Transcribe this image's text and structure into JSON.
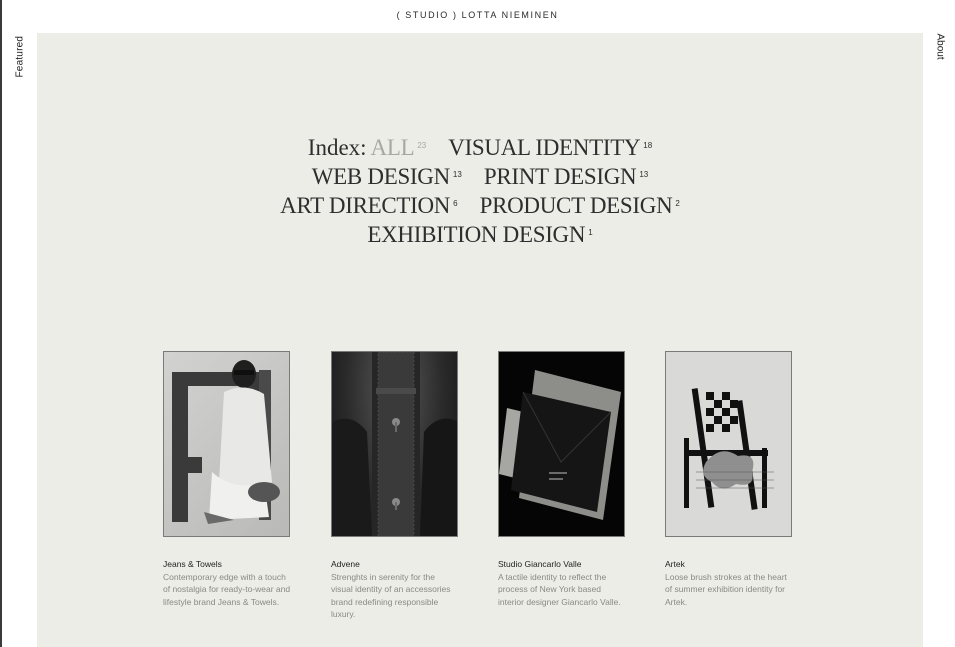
{
  "header": {
    "logo": "( STUDIO )  LOTTA  NIEMINEN"
  },
  "side_nav": {
    "left": "Featured",
    "right": "About"
  },
  "index": {
    "label": "Index:",
    "categories": [
      {
        "name": "ALL",
        "count": "23"
      },
      {
        "name": "VISUAL IDENTITY",
        "count": "18"
      },
      {
        "name": "WEB DESIGN",
        "count": "13"
      },
      {
        "name": "PRINT DESIGN",
        "count": "13"
      },
      {
        "name": "ART DIRECTION",
        "count": "6"
      },
      {
        "name": "PRODUCT DESIGN",
        "count": "2"
      },
      {
        "name": "EXHIBITION DESIGN",
        "count": "1"
      }
    ]
  },
  "projects": [
    {
      "title": "Jeans & Towels",
      "description": "Contemporary edge with a touch of nostalgia for ready-to-wear and lifestyle brand Jeans & Towels."
    },
    {
      "title": "Advene",
      "description": "Strenghts in serenity for the visual identity of an accessories brand redefining responsible luxury."
    },
    {
      "title": "Studio Giancarlo Valle",
      "description": "A tactile identity to reflect the process of New York based interior designer Giancarlo Valle."
    },
    {
      "title": "Artek",
      "description": "Loose brush strokes at the heart of summer exhibition identity for Artek."
    }
  ],
  "colors": {
    "panel": "#edede7",
    "inactive": "#a8a8a2",
    "text": "#2e2e2e"
  }
}
